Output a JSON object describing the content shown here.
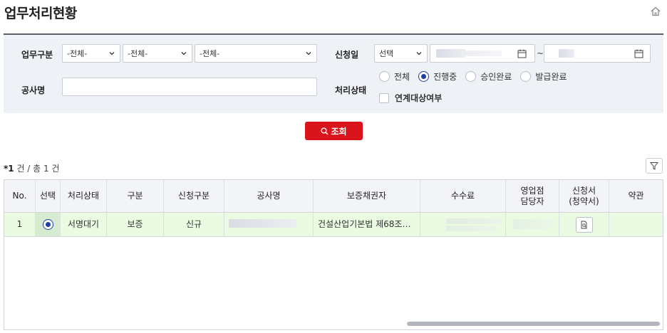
{
  "page": {
    "title": "업무처리현황"
  },
  "search": {
    "business_type_label": "업무구분",
    "business_type_select_1": "-전체-",
    "business_type_select_2": "-전체-",
    "business_type_select_3": "-전체-",
    "apply_date_label": "신청일",
    "apply_date_select": "선택",
    "date_separator": "~",
    "construction_name_label": "공사명",
    "construction_name_value": "",
    "status_label": "처리상태",
    "status_options": [
      "전체",
      "진행중",
      "승인완료",
      "발급완료"
    ],
    "status_selected": "진행중",
    "linked_check_label": "연계대상여부",
    "search_button_label": "조회"
  },
  "result": {
    "count_prefix": "*",
    "count": "1",
    "count_suffix": " 건 / 총 1 건"
  },
  "grid": {
    "headers": {
      "no": "No.",
      "select": "선택",
      "status": "처리상태",
      "type": "구분",
      "apply_type": "신청구분",
      "construction_name": "공사명",
      "guarantee_creditor": "보증채권자",
      "fee": "수수료",
      "sales_manager_1": "영업점",
      "sales_manager_2": "담당자",
      "application_1": "신청서",
      "application_2": "(청약서)",
      "terms": "약관"
    },
    "rows": [
      {
        "no": "1",
        "status": "서명대기",
        "type": "보증",
        "apply_type": "신규",
        "guarantee_creditor": "건설산업기본법 제68조…"
      }
    ]
  },
  "colors": {
    "accent": "#d9141b",
    "radio": "#1e3fa0",
    "row_highlight": "#eafbe2",
    "panel": "#eef1f6"
  }
}
